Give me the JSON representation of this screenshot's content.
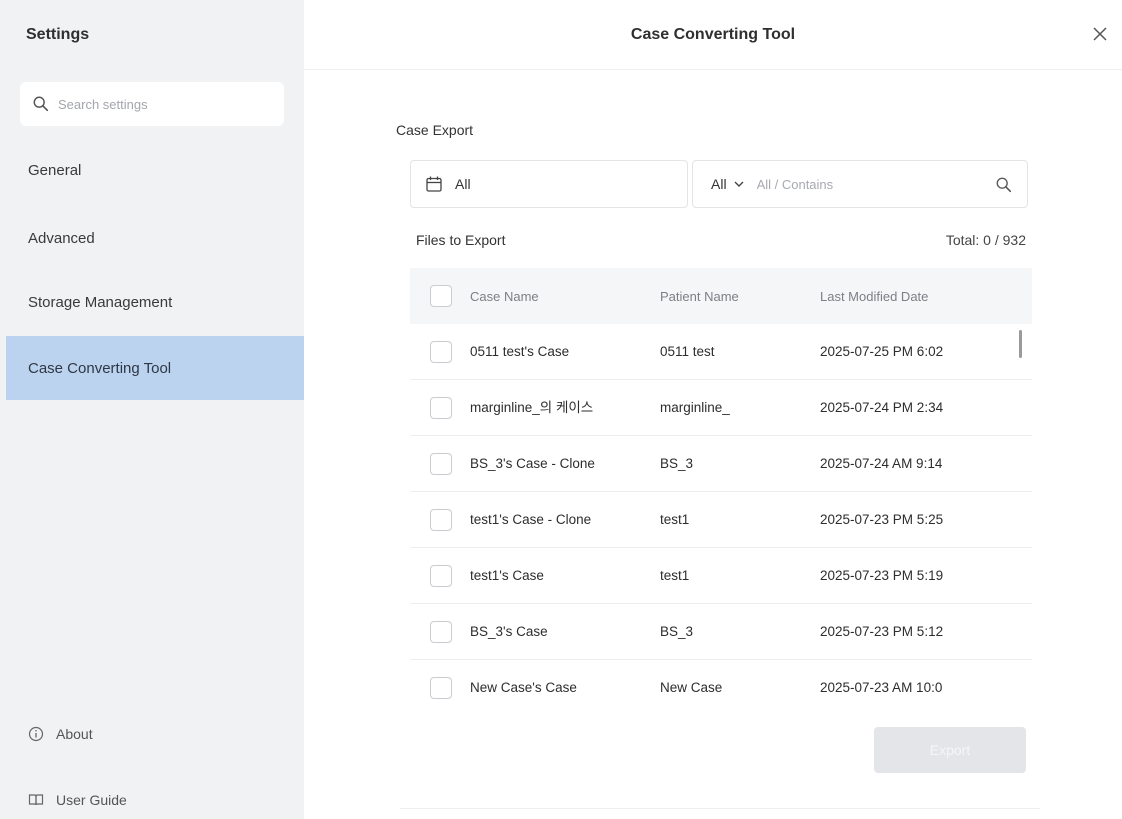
{
  "sidebar": {
    "title": "Settings",
    "search_placeholder": "Search settings",
    "items": [
      {
        "label": "General"
      },
      {
        "label": "Advanced"
      },
      {
        "label": "Storage Management"
      },
      {
        "label": "Case Converting Tool",
        "active": true
      }
    ],
    "bottom": {
      "about": "About",
      "user_guide": "User Guide"
    }
  },
  "header": {
    "title": "Case Converting Tool",
    "close_icon": "close-icon"
  },
  "main": {
    "section_title": "Case Export",
    "date_filter": {
      "value": "All",
      "icon": "calendar-icon"
    },
    "search_filter": {
      "select_value": "All",
      "placeholder": "All / Contains",
      "icon": "search-icon"
    },
    "files_label": "Files to Export",
    "total_label": "Total: 0 / 932",
    "table": {
      "columns": [
        "Case Name",
        "Patient Name",
        "Last Modified Date"
      ],
      "rows": [
        {
          "case_name": "0511 test's Case",
          "patient_name": "0511 test",
          "date": "2025-07-25 PM 6:02"
        },
        {
          "case_name": "marginline_의 케이스",
          "patient_name": "marginline_",
          "date": "2025-07-24 PM 2:34"
        },
        {
          "case_name": "BS_3's Case - Clone",
          "patient_name": "BS_3",
          "date": "2025-07-24 AM 9:14"
        },
        {
          "case_name": "test1's Case - Clone",
          "patient_name": "test1",
          "date": "2025-07-23 PM 5:25"
        },
        {
          "case_name": "test1's Case",
          "patient_name": "test1",
          "date": "2025-07-23 PM 5:19"
        },
        {
          "case_name": "BS_3's Case",
          "patient_name": "BS_3",
          "date": "2025-07-23 PM 5:12"
        },
        {
          "case_name": "New Case's Case",
          "patient_name": "New Case",
          "date": "2025-07-23 AM 10:0"
        }
      ]
    },
    "export_button": "Export"
  }
}
